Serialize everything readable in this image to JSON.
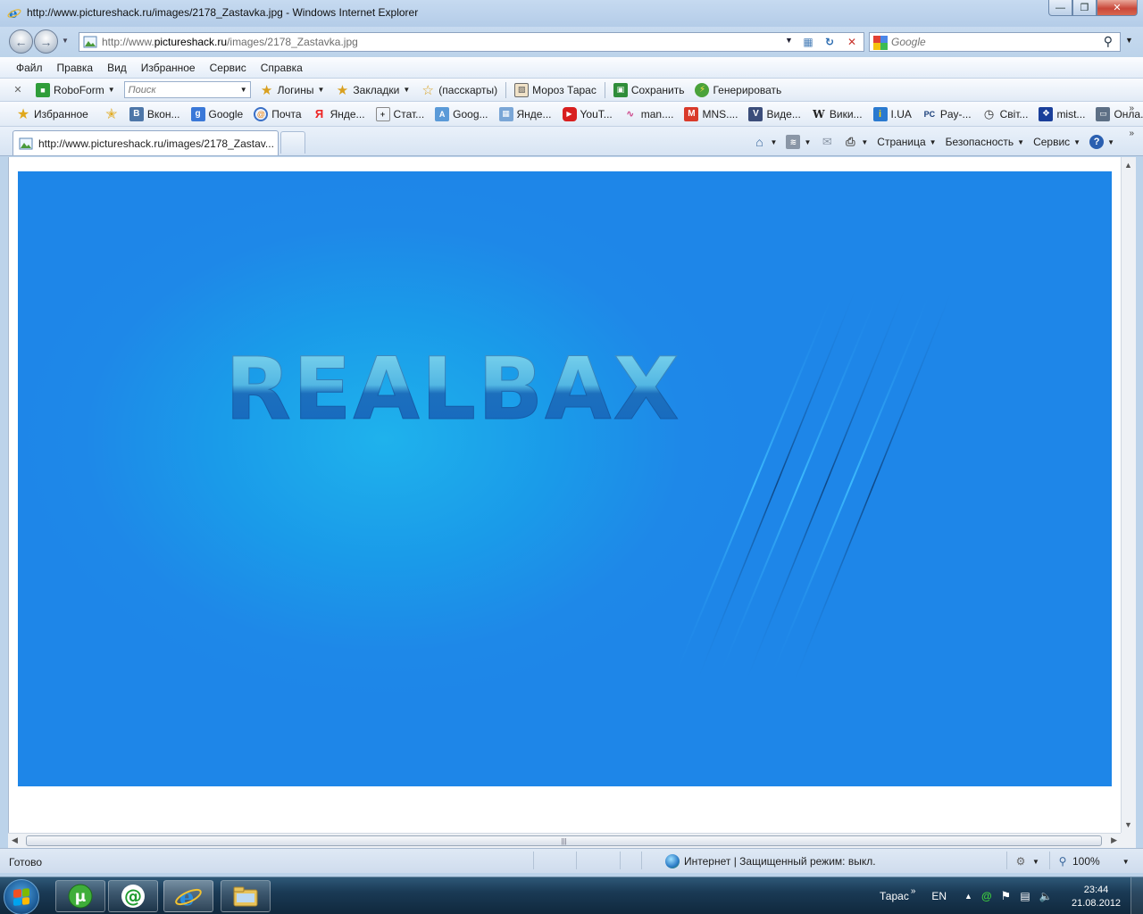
{
  "window": {
    "title": "http://www.pictureshack.ru/images/2178_Zastavka.jpg - Windows Internet Explorer"
  },
  "address_bar": {
    "url_prefix": "http://www.",
    "url_domain": "pictureshack.ru",
    "url_path": "/images/2178_Zastavka.jpg",
    "search_placeholder": "Google"
  },
  "menu": [
    "Файл",
    "Правка",
    "Вид",
    "Избранное",
    "Сервис",
    "Справка"
  ],
  "roboform_toolbar": {
    "brand": "RoboForm",
    "search_placeholder": "Поиск",
    "logins": "Логины",
    "bookmarks": "Закладки",
    "passcards": "(пасскарты)",
    "user": "Мороз Тарас",
    "save": "Сохранить",
    "generate": "Генерировать"
  },
  "favorites_bar": {
    "favorites_label": "Избранное",
    "links": [
      "Вкон...",
      "Google",
      "Почта",
      "Янде...",
      "Стат...",
      "Goog...",
      "Янде...",
      "YouT...",
      "man....",
      "MNS....",
      "Виде...",
      "Вики...",
      "I.UA",
      "Pay-...",
      "Світ...",
      "mist...",
      "Онла..."
    ]
  },
  "tab": {
    "title": "http://www.pictureshack.ru/images/2178_Zastav..."
  },
  "command_bar": {
    "page": "Страница",
    "safety": "Безопасность",
    "tools": "Сервис"
  },
  "content": {
    "logo_text": "REALBAX"
  },
  "status_bar": {
    "ready": "Готово",
    "zone": "Интернет | Защищенный режим: выкл.",
    "zoom": "100%"
  },
  "taskbar": {
    "user": "Тарас",
    "language": "EN",
    "time": "23:44",
    "date": "21.08.2012"
  },
  "colors": {
    "image_bg": "#1e86e8",
    "image_glow": "#1fb2ec",
    "close_button": "#c9483a"
  }
}
